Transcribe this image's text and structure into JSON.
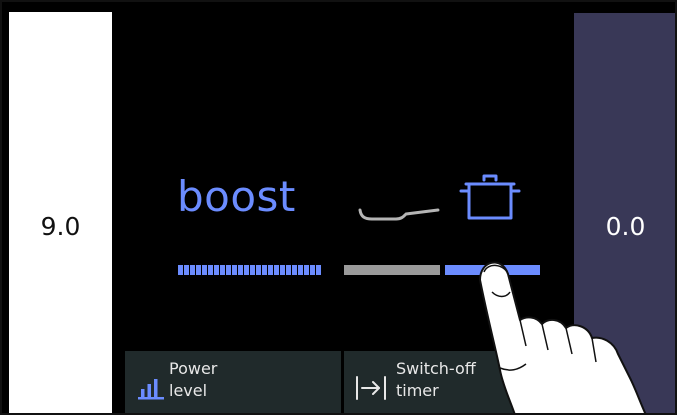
{
  "left_zone": {
    "value": "9.0"
  },
  "right_zone": {
    "value": "0.0"
  },
  "center": {
    "mode_label": "boost",
    "cookware_icons": [
      "pan-icon",
      "pot-icon"
    ]
  },
  "buttons": {
    "power_level": {
      "label": "Power\nlevel",
      "icon": "power-level-icon"
    },
    "switch_off_timer": {
      "label": "Switch-off\ntimer",
      "icon": "timer-arrow-icon"
    }
  },
  "colors": {
    "accent_blue": "#6b8cff",
    "background": "#000000",
    "right_panel": "#393857",
    "left_panel": "#ffffff",
    "button_bg": "#202a2b",
    "pan_bar": "#9a9a9a"
  }
}
